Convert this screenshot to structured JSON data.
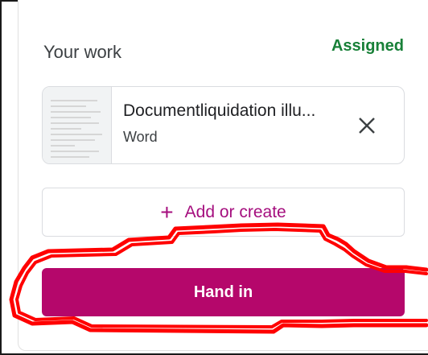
{
  "your_work": {
    "title": "Your work",
    "status": "Assigned",
    "status_color": "#188038"
  },
  "attachment": {
    "name": "Documentliquidation illu...",
    "type": "Word",
    "remove_icon": "close-icon"
  },
  "add_or_create": {
    "icon": "plus-icon",
    "label": "Add or create",
    "color": "#a50e7e"
  },
  "hand_in": {
    "label": "Hand in",
    "color": "#b5076b"
  },
  "annotation": {
    "shape": "freehand-outline",
    "color": "#ff0000"
  }
}
